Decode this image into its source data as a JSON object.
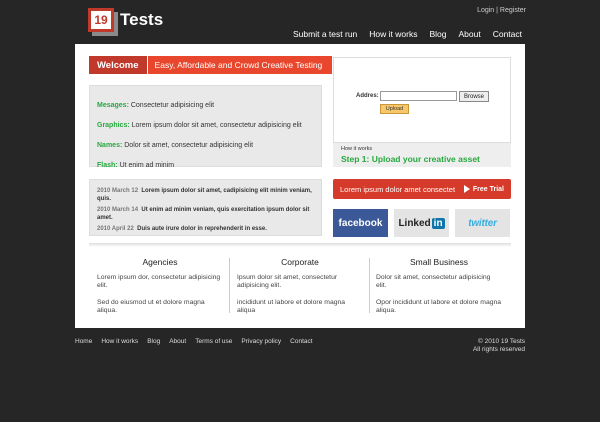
{
  "brand": {
    "logo_number": "19",
    "name": "Tests"
  },
  "toplinks": {
    "login": "Login",
    "separator": " | ",
    "register": "Register"
  },
  "nav": [
    "Submit a test run",
    "How it works",
    "Blog",
    "About",
    "Contact"
  ],
  "welcome": {
    "label": "Welcome",
    "tagline": "Easy, Affordable and Crowd Creative Testing"
  },
  "features": [
    {
      "name": "Mesages:",
      "text": "Consectetur adipisicing elit"
    },
    {
      "name": "Graphics:",
      "text": "Lorem ipsum dolor sit amet, consectetur adipisicing elit"
    },
    {
      "name": "Names:",
      "text": "Dolor sit amet, consectetur adipisicing elit"
    },
    {
      "name": "Flash:",
      "text": "Ut enim ad minim"
    }
  ],
  "news": [
    {
      "date": "2010 March 12",
      "text": "Lorem ipsum dolor sit amet, cadipisicing elit minim veniam, quis."
    },
    {
      "date": "2010 March 14",
      "text": "Ut enim ad minim veniam, quis exercitation ipsum dolor sit amet."
    },
    {
      "date": "2010 April 22",
      "text": "Duis aute irure dolor in reprehenderit in esse."
    }
  ],
  "upload": {
    "label": "Addres:",
    "browse": "Browse",
    "button": "Upload",
    "input_value": ""
  },
  "how": {
    "title": "How it works",
    "step": "Step 1: Upload your creative asset"
  },
  "trial": {
    "text": "Lorem ipsum dolor amet consectet",
    "button": "Free Trial"
  },
  "social": {
    "facebook": "facebook",
    "linkedin_a": "Linked",
    "linkedin_b": "in",
    "twitter": "twitter"
  },
  "columns": [
    {
      "title": "Agencies",
      "p1": "Lorem ipsum dor, consectetur adipisicing elit.",
      "p2": "Sed do eiusmod ut et dolore magna aliqua."
    },
    {
      "title": "Corporate",
      "p1": "Ipsum dolor sit amet, consectetur adipisicing elit.",
      "p2": "incididunt ut labore et dolore magna aliqua"
    },
    {
      "title": "Small Business",
      "p1": "Dolor sit amet, consectetur adipisicing elit.",
      "p2": "Opor incididunt ut labore et dolore magna aliqua."
    }
  ],
  "footer": {
    "links": [
      "Home",
      "How it works",
      "Blog",
      "About",
      "Terms of use",
      "Privacy policy",
      "Contact"
    ],
    "copyright": "© 2010 19 Tests",
    "rights": "All rights reserved"
  },
  "colors": {
    "background": "#262626",
    "accent_red": "#c0392b",
    "green": "#27a83f",
    "facebook": "#3b5998"
  }
}
